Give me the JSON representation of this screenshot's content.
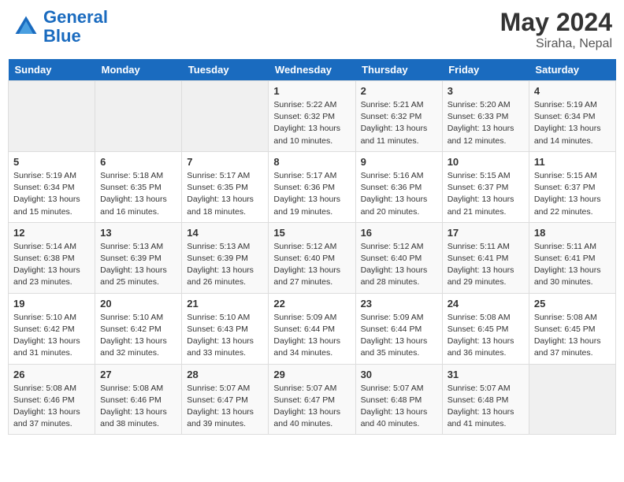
{
  "header": {
    "logo_line1": "General",
    "logo_line2": "Blue",
    "month_year": "May 2024",
    "location": "Siraha, Nepal"
  },
  "weekdays": [
    "Sunday",
    "Monday",
    "Tuesday",
    "Wednesday",
    "Thursday",
    "Friday",
    "Saturday"
  ],
  "weeks": [
    [
      {
        "num": "",
        "sunrise": "",
        "sunset": "",
        "daylight": ""
      },
      {
        "num": "",
        "sunrise": "",
        "sunset": "",
        "daylight": ""
      },
      {
        "num": "",
        "sunrise": "",
        "sunset": "",
        "daylight": ""
      },
      {
        "num": "1",
        "sunrise": "Sunrise: 5:22 AM",
        "sunset": "Sunset: 6:32 PM",
        "daylight": "Daylight: 13 hours and 10 minutes."
      },
      {
        "num": "2",
        "sunrise": "Sunrise: 5:21 AM",
        "sunset": "Sunset: 6:32 PM",
        "daylight": "Daylight: 13 hours and 11 minutes."
      },
      {
        "num": "3",
        "sunrise": "Sunrise: 5:20 AM",
        "sunset": "Sunset: 6:33 PM",
        "daylight": "Daylight: 13 hours and 12 minutes."
      },
      {
        "num": "4",
        "sunrise": "Sunrise: 5:19 AM",
        "sunset": "Sunset: 6:34 PM",
        "daylight": "Daylight: 13 hours and 14 minutes."
      }
    ],
    [
      {
        "num": "5",
        "sunrise": "Sunrise: 5:19 AM",
        "sunset": "Sunset: 6:34 PM",
        "daylight": "Daylight: 13 hours and 15 minutes."
      },
      {
        "num": "6",
        "sunrise": "Sunrise: 5:18 AM",
        "sunset": "Sunset: 6:35 PM",
        "daylight": "Daylight: 13 hours and 16 minutes."
      },
      {
        "num": "7",
        "sunrise": "Sunrise: 5:17 AM",
        "sunset": "Sunset: 6:35 PM",
        "daylight": "Daylight: 13 hours and 18 minutes."
      },
      {
        "num": "8",
        "sunrise": "Sunrise: 5:17 AM",
        "sunset": "Sunset: 6:36 PM",
        "daylight": "Daylight: 13 hours and 19 minutes."
      },
      {
        "num": "9",
        "sunrise": "Sunrise: 5:16 AM",
        "sunset": "Sunset: 6:36 PM",
        "daylight": "Daylight: 13 hours and 20 minutes."
      },
      {
        "num": "10",
        "sunrise": "Sunrise: 5:15 AM",
        "sunset": "Sunset: 6:37 PM",
        "daylight": "Daylight: 13 hours and 21 minutes."
      },
      {
        "num": "11",
        "sunrise": "Sunrise: 5:15 AM",
        "sunset": "Sunset: 6:37 PM",
        "daylight": "Daylight: 13 hours and 22 minutes."
      }
    ],
    [
      {
        "num": "12",
        "sunrise": "Sunrise: 5:14 AM",
        "sunset": "Sunset: 6:38 PM",
        "daylight": "Daylight: 13 hours and 23 minutes."
      },
      {
        "num": "13",
        "sunrise": "Sunrise: 5:13 AM",
        "sunset": "Sunset: 6:39 PM",
        "daylight": "Daylight: 13 hours and 25 minutes."
      },
      {
        "num": "14",
        "sunrise": "Sunrise: 5:13 AM",
        "sunset": "Sunset: 6:39 PM",
        "daylight": "Daylight: 13 hours and 26 minutes."
      },
      {
        "num": "15",
        "sunrise": "Sunrise: 5:12 AM",
        "sunset": "Sunset: 6:40 PM",
        "daylight": "Daylight: 13 hours and 27 minutes."
      },
      {
        "num": "16",
        "sunrise": "Sunrise: 5:12 AM",
        "sunset": "Sunset: 6:40 PM",
        "daylight": "Daylight: 13 hours and 28 minutes."
      },
      {
        "num": "17",
        "sunrise": "Sunrise: 5:11 AM",
        "sunset": "Sunset: 6:41 PM",
        "daylight": "Daylight: 13 hours and 29 minutes."
      },
      {
        "num": "18",
        "sunrise": "Sunrise: 5:11 AM",
        "sunset": "Sunset: 6:41 PM",
        "daylight": "Daylight: 13 hours and 30 minutes."
      }
    ],
    [
      {
        "num": "19",
        "sunrise": "Sunrise: 5:10 AM",
        "sunset": "Sunset: 6:42 PM",
        "daylight": "Daylight: 13 hours and 31 minutes."
      },
      {
        "num": "20",
        "sunrise": "Sunrise: 5:10 AM",
        "sunset": "Sunset: 6:42 PM",
        "daylight": "Daylight: 13 hours and 32 minutes."
      },
      {
        "num": "21",
        "sunrise": "Sunrise: 5:10 AM",
        "sunset": "Sunset: 6:43 PM",
        "daylight": "Daylight: 13 hours and 33 minutes."
      },
      {
        "num": "22",
        "sunrise": "Sunrise: 5:09 AM",
        "sunset": "Sunset: 6:44 PM",
        "daylight": "Daylight: 13 hours and 34 minutes."
      },
      {
        "num": "23",
        "sunrise": "Sunrise: 5:09 AM",
        "sunset": "Sunset: 6:44 PM",
        "daylight": "Daylight: 13 hours and 35 minutes."
      },
      {
        "num": "24",
        "sunrise": "Sunrise: 5:08 AM",
        "sunset": "Sunset: 6:45 PM",
        "daylight": "Daylight: 13 hours and 36 minutes."
      },
      {
        "num": "25",
        "sunrise": "Sunrise: 5:08 AM",
        "sunset": "Sunset: 6:45 PM",
        "daylight": "Daylight: 13 hours and 37 minutes."
      }
    ],
    [
      {
        "num": "26",
        "sunrise": "Sunrise: 5:08 AM",
        "sunset": "Sunset: 6:46 PM",
        "daylight": "Daylight: 13 hours and 37 minutes."
      },
      {
        "num": "27",
        "sunrise": "Sunrise: 5:08 AM",
        "sunset": "Sunset: 6:46 PM",
        "daylight": "Daylight: 13 hours and 38 minutes."
      },
      {
        "num": "28",
        "sunrise": "Sunrise: 5:07 AM",
        "sunset": "Sunset: 6:47 PM",
        "daylight": "Daylight: 13 hours and 39 minutes."
      },
      {
        "num": "29",
        "sunrise": "Sunrise: 5:07 AM",
        "sunset": "Sunset: 6:47 PM",
        "daylight": "Daylight: 13 hours and 40 minutes."
      },
      {
        "num": "30",
        "sunrise": "Sunrise: 5:07 AM",
        "sunset": "Sunset: 6:48 PM",
        "daylight": "Daylight: 13 hours and 40 minutes."
      },
      {
        "num": "31",
        "sunrise": "Sunrise: 5:07 AM",
        "sunset": "Sunset: 6:48 PM",
        "daylight": "Daylight: 13 hours and 41 minutes."
      },
      {
        "num": "",
        "sunrise": "",
        "sunset": "",
        "daylight": ""
      }
    ]
  ]
}
